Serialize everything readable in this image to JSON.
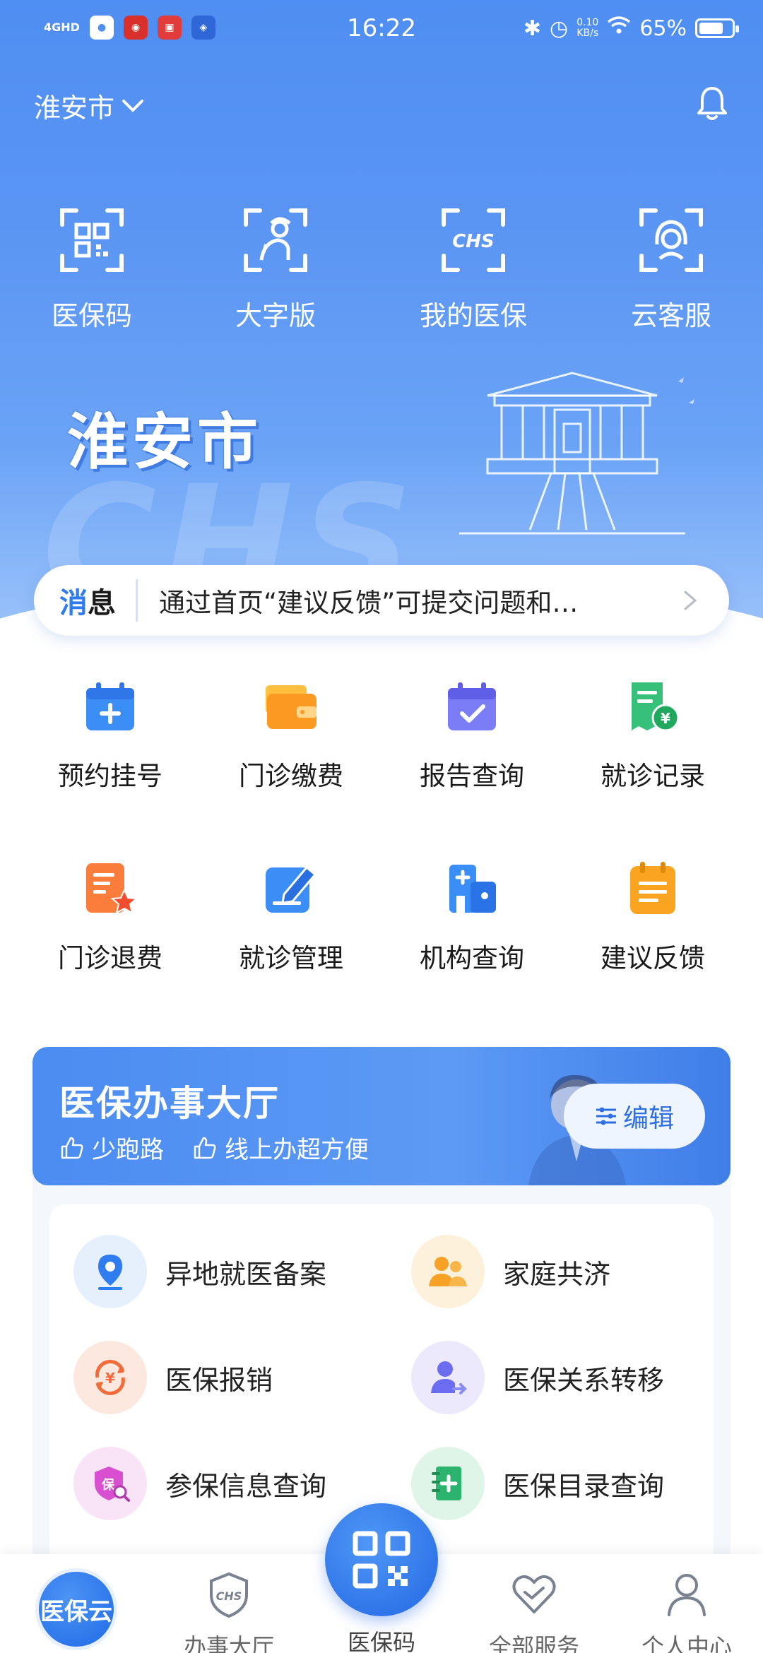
{
  "status_bar": {
    "signal": "4GHD",
    "time": "16:22",
    "net_speed_value": "0.10",
    "net_speed_unit": "KB/s",
    "battery": "65%",
    "battery_level": 0.65
  },
  "header": {
    "city": "淮安市"
  },
  "quick_actions": [
    {
      "label": "医保码",
      "icon": "qr-code-icon"
    },
    {
      "label": "大字版",
      "icon": "elder-person-icon"
    },
    {
      "label": "我的医保",
      "icon": "chs-icon"
    },
    {
      "label": "云客服",
      "icon": "headset-icon"
    }
  ],
  "banner": {
    "city_title": "淮安市",
    "watermark": "CHS"
  },
  "notice": {
    "tag_part1": "消",
    "tag_part2": "息",
    "text": "通过首页“建议反馈”可提交问题和…"
  },
  "services": [
    {
      "label": "预约挂号",
      "icon": "calendar-plus-icon"
    },
    {
      "label": "门诊缴费",
      "icon": "wallet-icon"
    },
    {
      "label": "报告查询",
      "icon": "calendar-check-icon"
    },
    {
      "label": "就诊记录",
      "icon": "receipt-yuan-icon"
    },
    {
      "label": "门诊退费",
      "icon": "refund-star-icon"
    },
    {
      "label": "就诊管理",
      "icon": "edit-note-icon"
    },
    {
      "label": "机构查询",
      "icon": "hospital-building-icon"
    },
    {
      "label": "建议反馈",
      "icon": "clipboard-icon"
    }
  ],
  "hall": {
    "title": "医保办事大厅",
    "tag1": "少跑路",
    "tag2": "线上办超方便",
    "edit_label": "编辑",
    "items": [
      {
        "label": "异地就医备案",
        "icon": "location-pin-icon",
        "color": "#2f7bf0",
        "bg": "#e6f0fd"
      },
      {
        "label": "家庭共济",
        "icon": "family-icon",
        "color": "#f5a227",
        "bg": "#fdf1dc"
      },
      {
        "label": "医保报销",
        "icon": "reimburse-icon",
        "color": "#f26b3a",
        "bg": "#fde8df"
      },
      {
        "label": "医保关系转移",
        "icon": "transfer-user-icon",
        "color": "#6b6cf0",
        "bg": "#ebe9fb"
      },
      {
        "label": "参保信息查询",
        "icon": "insurance-search-icon",
        "color": "#d84fd0",
        "bg": "#f8e4f6"
      },
      {
        "label": "医保目录查询",
        "icon": "catalog-book-icon",
        "color": "#2cb36d",
        "bg": "#dff5e8"
      }
    ]
  },
  "tabbar": {
    "home_label": "医保云",
    "tabs": [
      {
        "label": "办事大厅",
        "icon": "chs-shield-icon"
      },
      {
        "label": "医保码",
        "icon": "qr-code-icon"
      },
      {
        "label": "全部服务",
        "icon": "heart-icon"
      },
      {
        "label": "个人中心",
        "icon": "user-icon"
      }
    ]
  }
}
